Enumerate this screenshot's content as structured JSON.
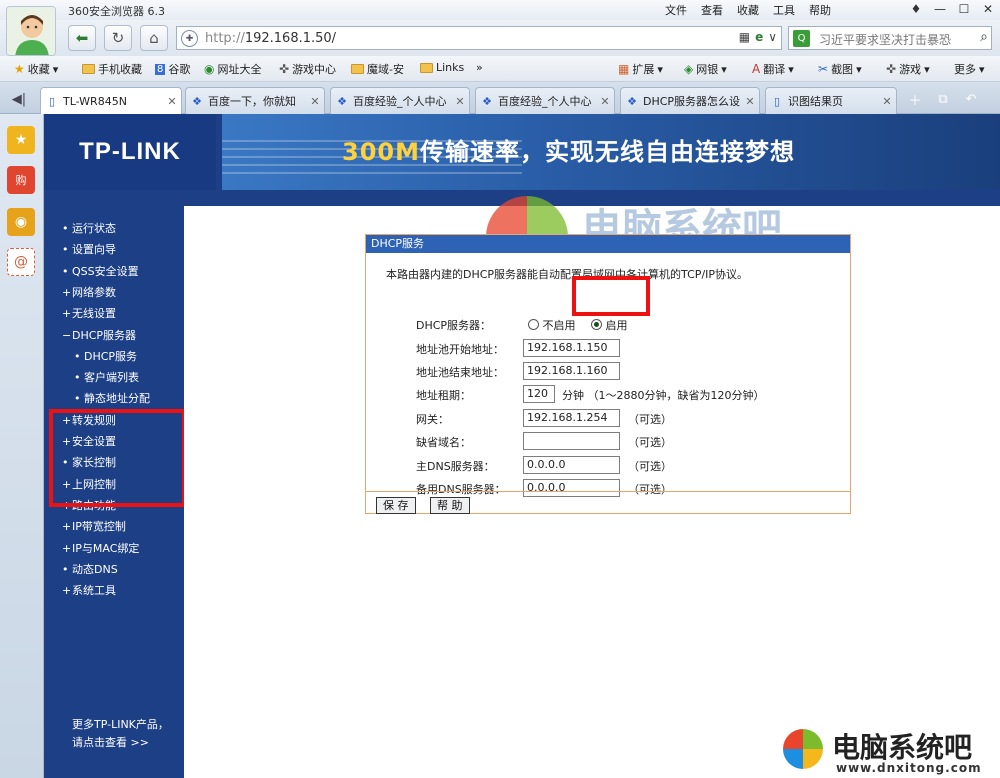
{
  "browser": {
    "title": "360安全浏览器 6.3",
    "menu": [
      "文件",
      "查看",
      "收藏",
      "工具",
      "帮助"
    ],
    "url_protocol": "http://",
    "url_host": "192.168.1.50/",
    "search_text": "习近平要求坚决打击暴恐",
    "bookmarks": [
      {
        "label": "收藏",
        "icon": "star-icon"
      },
      {
        "label": "手机收藏",
        "icon": "folder-icon"
      },
      {
        "label": "谷歌",
        "icon": "google-icon"
      },
      {
        "label": "网址大全",
        "icon": "globe-icon"
      },
      {
        "label": "游戏中心",
        "icon": "gamepad-icon"
      },
      {
        "label": "魔域-安",
        "icon": "folder-icon"
      },
      {
        "label": "Links",
        "icon": "folder-icon"
      }
    ],
    "toolbar_right": [
      {
        "label": "扩展",
        "icon": "grid-icon"
      },
      {
        "label": "网银",
        "icon": "bank-icon"
      },
      {
        "label": "翻译",
        "icon": "translate-icon"
      },
      {
        "label": "截图",
        "icon": "screenshot-icon"
      },
      {
        "label": "游戏",
        "icon": "gamepad-icon"
      },
      {
        "label": "更多",
        "icon": "more-icon"
      }
    ],
    "tabs": [
      {
        "label": "TL-WR845N",
        "active": true
      },
      {
        "label": "百度一下，你就知",
        "active": false
      },
      {
        "label": "百度经验_个人中心",
        "active": false
      },
      {
        "label": "百度经验_个人中心",
        "active": false
      },
      {
        "label": "DHCP服务器怎么设",
        "active": false
      },
      {
        "label": "识图结果页",
        "active": false
      }
    ]
  },
  "router": {
    "brand": "TP-LINK",
    "slogan_highlight": "300M",
    "slogan_rest": "传输速率，实现无线自由连接梦想",
    "nav": [
      {
        "label": "运行状态",
        "type": "item"
      },
      {
        "label": "设置向导",
        "type": "item"
      },
      {
        "label": "QSS安全设置",
        "type": "item"
      },
      {
        "label": "网络参数",
        "type": "group"
      },
      {
        "label": "无线设置",
        "type": "group"
      },
      {
        "label": "DHCP服务器",
        "type": "group-open"
      },
      {
        "label": "DHCP服务",
        "type": "sub"
      },
      {
        "label": "客户端列表",
        "type": "sub"
      },
      {
        "label": "静态地址分配",
        "type": "sub"
      },
      {
        "label": "转发规则",
        "type": "group"
      },
      {
        "label": "安全设置",
        "type": "group"
      },
      {
        "label": "家长控制",
        "type": "item"
      },
      {
        "label": "上网控制",
        "type": "group"
      },
      {
        "label": "路由功能",
        "type": "group"
      },
      {
        "label": "IP带宽控制",
        "type": "group"
      },
      {
        "label": "IP与MAC绑定",
        "type": "group"
      },
      {
        "label": "动态DNS",
        "type": "item"
      },
      {
        "label": "系统工具",
        "type": "group"
      }
    ],
    "more_line1": "更多TP-LINK产品，",
    "more_line2": "请点击查看 >>"
  },
  "dhcp": {
    "header": "DHCP服务",
    "intro": "本路由器内建的DHCP服务器能自动配置局域网中各计算机的TCP/IP协议。",
    "server_label": "DHCP服务器：",
    "option_off": "不启用",
    "option_on": "启用",
    "selected": "启用",
    "fields": [
      {
        "label": "地址池开始地址：",
        "value": "192.168.1.150",
        "hint": ""
      },
      {
        "label": "地址池结束地址：",
        "value": "192.168.1.160",
        "hint": ""
      },
      {
        "label": "地址租期：",
        "value": "120",
        "hint": "分钟 （1～2880分钟，缺省为120分钟）"
      },
      {
        "label": "网关：",
        "value": "192.168.1.254",
        "hint": "（可选）"
      },
      {
        "label": "缺省域名：",
        "value": "",
        "hint": "（可选）"
      },
      {
        "label": "主DNS服务器：",
        "value": "0.0.0.0",
        "hint": "（可选）"
      },
      {
        "label": "备用DNS服务器：",
        "value": "0.0.0.0",
        "hint": "（可选）"
      }
    ],
    "save_label": "保 存",
    "help_label": "帮 助"
  },
  "watermark": {
    "title": "电脑系统吧",
    "url": "www.dnxitong.com"
  }
}
